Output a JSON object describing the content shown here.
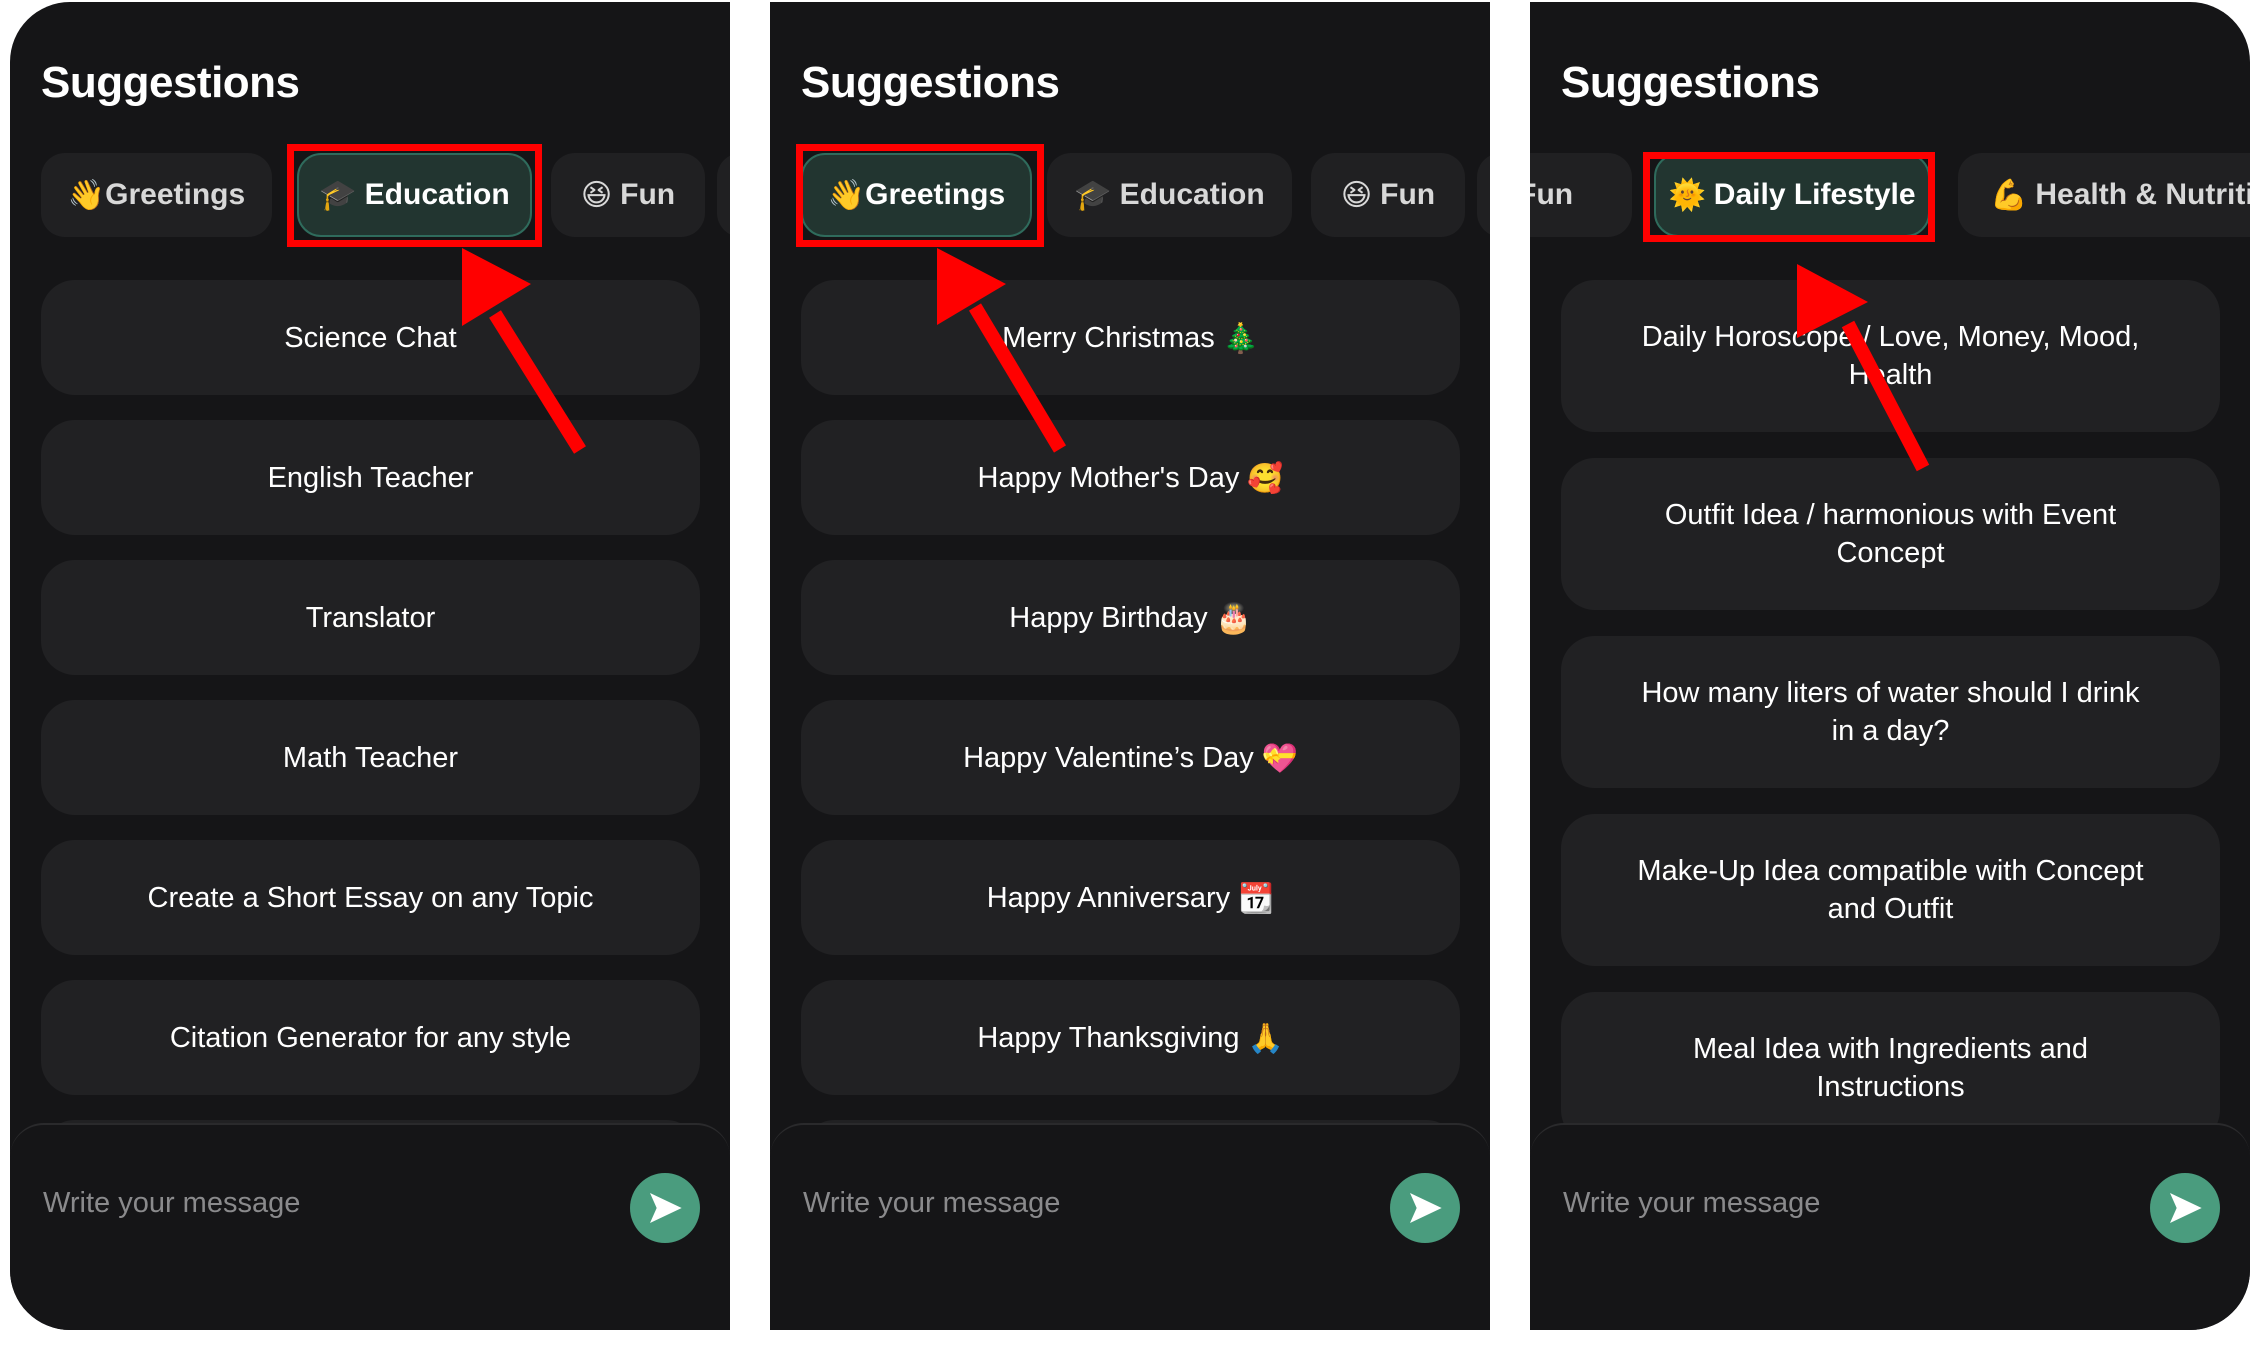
{
  "colors": {
    "panel_bg": "#151517",
    "card_bg": "#212123",
    "chip_bg": "#202022",
    "chip_selected_bg": "#223530",
    "chip_selected_border": "#2f6b5c",
    "send_button": "#4a9c7e",
    "annotation": "#ff0000"
  },
  "panels": [
    {
      "title": "Suggestions",
      "selected_tab": "Education",
      "tabs": [
        {
          "emoji": "👋",
          "label": "Greetings",
          "icon": "waving-hand-icon"
        },
        {
          "emoji": "🎓",
          "label": "Education",
          "icon": "graduation-cap-icon"
        },
        {
          "emoji": "😆",
          "label": "Fun",
          "icon": "laughing-face-icon"
        }
      ],
      "suggestions": [
        {
          "text": "Science Chat"
        },
        {
          "text": "English Teacher"
        },
        {
          "text": "Translator"
        },
        {
          "text": "Math Teacher"
        },
        {
          "text": "Create a Short Essay on any Topic"
        },
        {
          "text": "Citation Generator for any style"
        }
      ],
      "input_placeholder": "Write your message"
    },
    {
      "title": "Suggestions",
      "selected_tab": "Greetings",
      "tabs": [
        {
          "emoji": "👋",
          "label": "Greetings",
          "icon": "waving-hand-icon"
        },
        {
          "emoji": "🎓",
          "label": "Education",
          "icon": "graduation-cap-icon"
        },
        {
          "emoji": "😆",
          "label": "Fun",
          "icon": "laughing-face-icon"
        }
      ],
      "suggestions": [
        {
          "text": "Merry Christmas",
          "emoji": "🎄"
        },
        {
          "text": "Happy Mother's Day",
          "emoji": "🥰"
        },
        {
          "text": "Happy Birthday",
          "emoji": "🎂"
        },
        {
          "text": "Happy Valentine’s Day",
          "emoji": "💝"
        },
        {
          "text": "Happy Anniversary",
          "emoji": "📆"
        },
        {
          "text": "Happy Thanksgiving",
          "emoji": "🙏"
        }
      ],
      "input_placeholder": "Write your message"
    },
    {
      "title": "Suggestions",
      "selected_tab": "Daily Lifestyle",
      "tabs": [
        {
          "emoji": "😆",
          "label": "Fun",
          "icon": "laughing-face-icon"
        },
        {
          "emoji": "🌞",
          "label": "Daily Lifestyle",
          "icon": "sun-face-icon"
        },
        {
          "emoji": "💪",
          "label": "Health & Nutrition",
          "icon": "flexed-biceps-icon"
        }
      ],
      "suggestions": [
        {
          "text": "Daily Horoscope / Love, Money, Mood, Health"
        },
        {
          "text": "Outfit Idea / harmonious with Event Concept"
        },
        {
          "text": "How many liters of water should I drink in a day?"
        },
        {
          "text": "Make-Up Idea compatible with Concept and Outfit"
        },
        {
          "text": "Meal Idea with Ingredients and Instructions"
        }
      ],
      "input_placeholder": "Write your message"
    }
  ]
}
